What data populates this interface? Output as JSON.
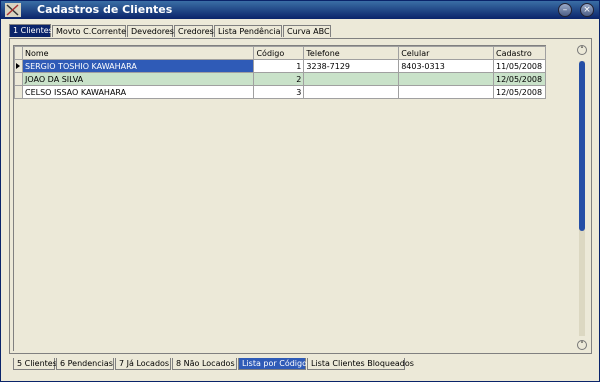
{
  "window": {
    "title": "Cadastros de Clientes"
  },
  "top_tabs": [
    {
      "label": "1 Clientes",
      "active": true
    },
    {
      "label": "Movto C.Corrente",
      "active": false
    },
    {
      "label": "Devedores",
      "active": false
    },
    {
      "label": "Credores",
      "active": false
    },
    {
      "label": "Lista Pendência",
      "active": false
    },
    {
      "label": "Curva ABC",
      "active": false
    }
  ],
  "grid": {
    "columns": [
      "Nome",
      "Código",
      "Telefone",
      "Celular",
      "Cadastro"
    ],
    "rows": [
      {
        "nome": "SERGIO TOSHIO KAWAHARA",
        "codigo": "1",
        "telefone": "3238-7129",
        "celular": "8403-0313",
        "cadastro": "11/05/2008"
      },
      {
        "nome": "JOAO DA SILVA",
        "codigo": "2",
        "telefone": "",
        "celular": "",
        "cadastro": "12/05/2008"
      },
      {
        "nome": "CELSO ISSAO KAWAHARA",
        "codigo": "3",
        "telefone": "",
        "celular": "",
        "cadastro": "12/05/2008"
      }
    ]
  },
  "bottom_tabs": [
    {
      "label": "5 Clientes",
      "active": false
    },
    {
      "label": "6 Pendencias",
      "active": false
    },
    {
      "label": "7 Já Locados",
      "active": false
    },
    {
      "label": "8 Não Locados",
      "active": false
    },
    {
      "label": "Lista por Código",
      "active": true
    },
    {
      "label": "Lista Clientes Bloqueados",
      "active": false
    }
  ],
  "colors": {
    "titlebar": "#0a246a",
    "selection": "#2f5bb7",
    "alt_row": "#c9e2c9",
    "background": "#ece9d8"
  }
}
